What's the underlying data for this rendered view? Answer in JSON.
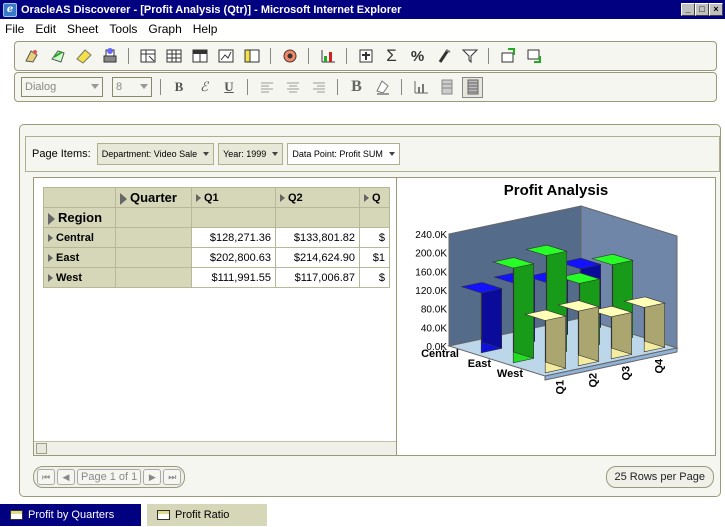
{
  "window": {
    "title": "OracleAS Discoverer - [Profit Analysis (Qtr)] - Microsoft Internet Explorer"
  },
  "menu": [
    "File",
    "Edit",
    "Sheet",
    "Tools",
    "Graph",
    "Help"
  ],
  "format_toolbar": {
    "font": "Dialog",
    "size": "8",
    "bold": "B",
    "italic": "ℰ",
    "underline": "U"
  },
  "page_items": {
    "label": "Page Items:",
    "items": [
      "Department: Video Sale",
      "Year: 1999",
      "Data Point: Profit SUM"
    ]
  },
  "crosstab": {
    "column_dimension": "Quarter",
    "row_dimension": "Region",
    "columns": [
      "Q1",
      "Q2",
      "Q"
    ],
    "rows": [
      {
        "label": "Central",
        "values": [
          "$128,271.36",
          "$133,801.82",
          "$"
        ]
      },
      {
        "label": "East",
        "values": [
          "$202,800.63",
          "$214,624.90",
          "$1"
        ]
      },
      {
        "label": "West",
        "values": [
          "$111,991.55",
          "$117,006.87",
          "$"
        ]
      }
    ]
  },
  "pager": {
    "page_text": "Page 1 of 1",
    "rows_per_page": "25 Rows per Page"
  },
  "tabs": [
    "Profit by Quarters",
    "Profit Ratio"
  ],
  "chart_data": {
    "type": "bar",
    "title": "Profit Analysis",
    "categories": [
      "Q1",
      "Q2",
      "Q3",
      "Q4"
    ],
    "series": [
      {
        "name": "Central",
        "values": [
          128271.36,
          133801.82,
          120000,
          135000
        ],
        "color": "#1010dd"
      },
      {
        "name": "East",
        "values": [
          202800.63,
          214624.9,
          140000,
          165000
        ],
        "color": "#22dd22"
      },
      {
        "name": "West",
        "values": [
          111991.55,
          117006.87,
          90000,
          95000
        ],
        "color": "#f4eca0"
      }
    ],
    "y_ticks": [
      "240.0K",
      "200.0K",
      "160.0K",
      "120.0K",
      "80.0K",
      "40.0K",
      "0.0K"
    ],
    "ylim": [
      0,
      240000
    ],
    "grid": false,
    "legend": "none"
  }
}
